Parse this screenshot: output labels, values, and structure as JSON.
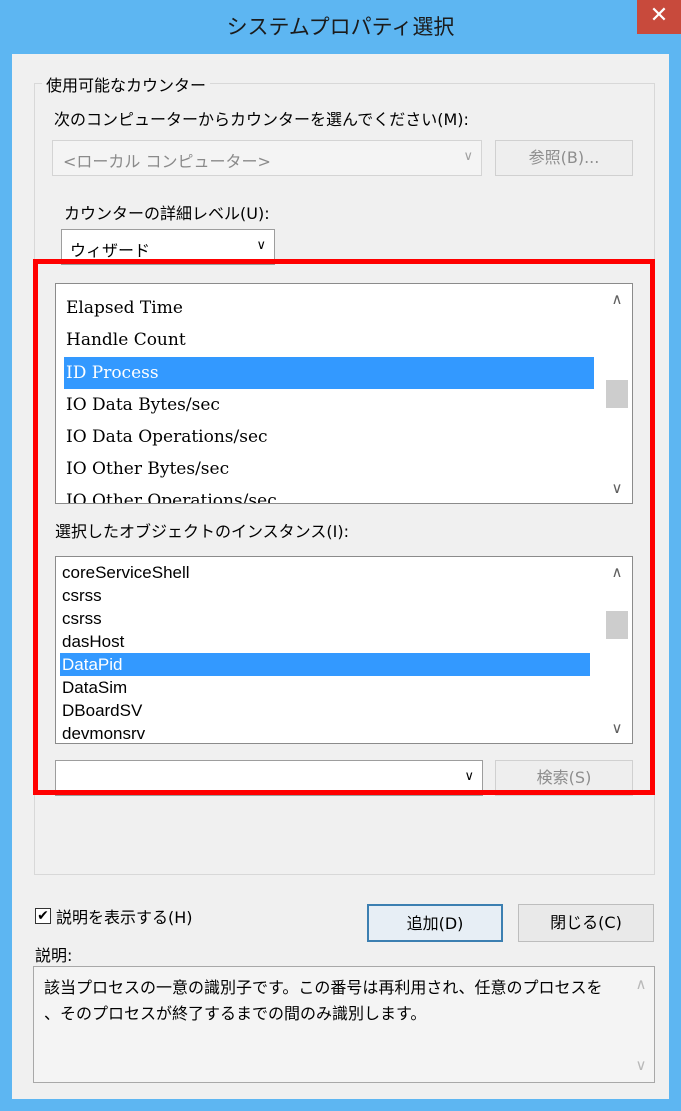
{
  "window": {
    "title": "システムプロパティ選択",
    "close_glyph": "✕"
  },
  "group": {
    "legend": "使用可能なカウンター"
  },
  "computer": {
    "label": "次のコンピューターからカウンターを選んでください(M):",
    "value": "<ローカル コンピューター>",
    "browse_label": "参照(B)..."
  },
  "detail": {
    "label": "カウンターの詳細レベル(U):",
    "value": "ウィザード"
  },
  "counters": {
    "items": [
      "Elapsed Time",
      "Handle Count",
      "ID Process",
      "IO Data Bytes/sec",
      "IO Data Operations/sec",
      "IO Other Bytes/sec",
      "IO Other Operations/sec"
    ],
    "selected": "ID Process"
  },
  "instances": {
    "label": "選択したオブジェクトのインスタンス(I):",
    "items": [
      "coreServiceShell",
      "csrss",
      "csrss",
      "dasHost",
      "DataPid",
      "DataSim",
      "DBoardSV",
      "devmonsrv"
    ],
    "selected": "DataPid"
  },
  "search": {
    "value": "",
    "button_label": "検索(S)"
  },
  "footer": {
    "show_description_label": "説明を表示する(H)",
    "show_description_checked": true,
    "add_label": "追加(D)",
    "close_label": "閉じる(C)",
    "description_heading": "説明:",
    "description_text": "該当プロセスの一意の識別子です。この番号は再利用され、任意のプロセスを\n、そのプロセスが終了するまでの間のみ識別します。"
  },
  "colors": {
    "titlebar": "#5db6f2",
    "selection": "#3399ff",
    "highlight_box": "#ff0000",
    "close_button": "#c84a3c"
  },
  "icons": [
    "close-icon",
    "chevron-down-icon",
    "chevron-up-icon",
    "check-icon"
  ]
}
